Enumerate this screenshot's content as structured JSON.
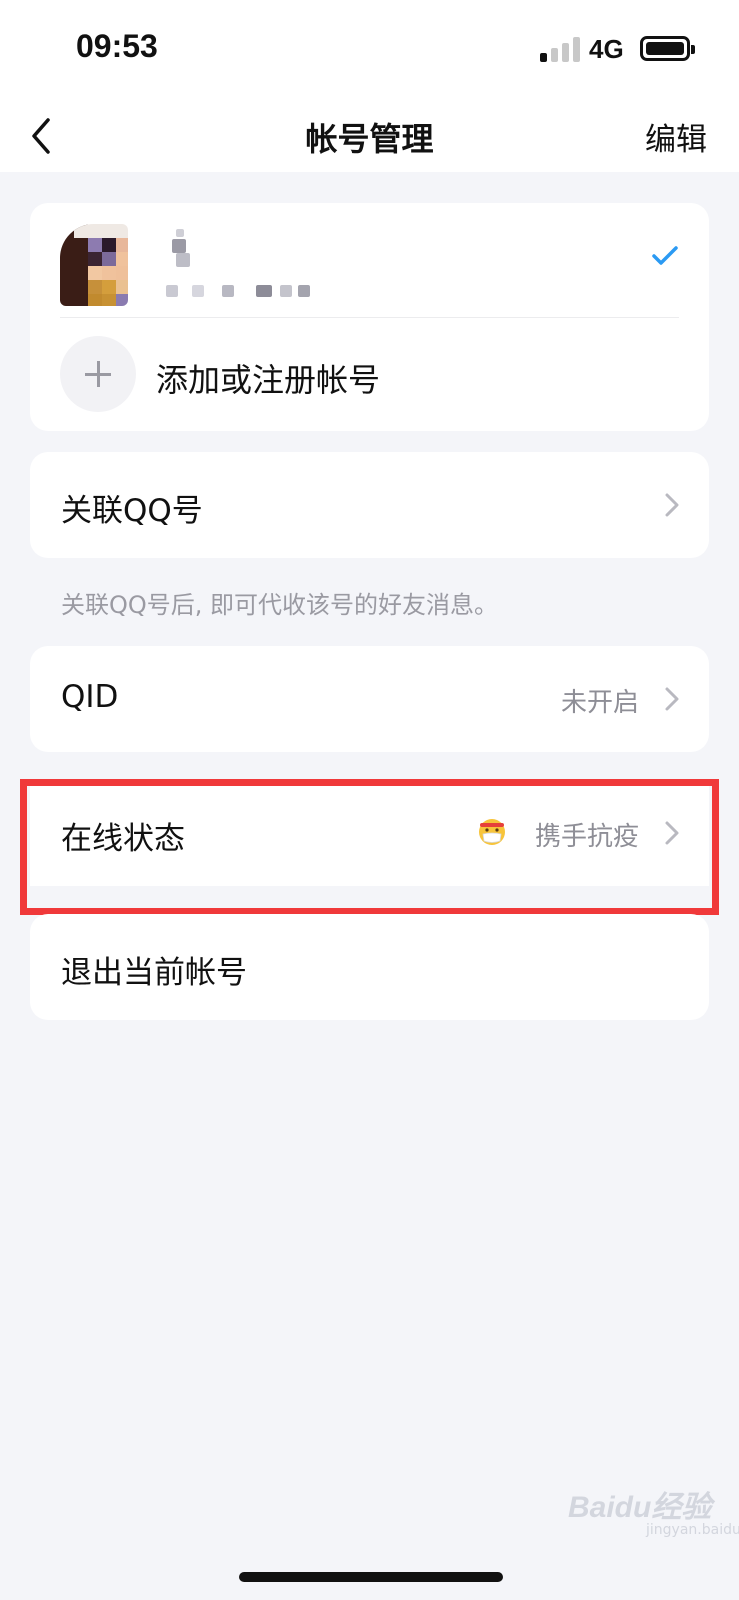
{
  "status_bar": {
    "time": "09:53",
    "network": "4G",
    "signal_bars_on": 1,
    "signal_bars_total": 4,
    "battery_level": 1.0
  },
  "nav": {
    "back_icon": "chevron-left-icon",
    "title": "帐号管理",
    "edit_label": "编辑"
  },
  "account_card": {
    "current_account_selected_icon": "checkmark-icon",
    "add_icon": "plus-icon",
    "add_label": "添加或注册帐号"
  },
  "settings": {
    "link_qq": {
      "label": "关联QQ号",
      "hint": "关联QQ号后, 即可代收该号的好友消息。"
    },
    "qid": {
      "label": "QID",
      "value": "未开启"
    },
    "online_status": {
      "label": "在线状态",
      "icon": "masked-face-emoji-icon",
      "value": "携手抗疫"
    },
    "logout": {
      "label": "退出当前帐号"
    }
  },
  "colors": {
    "background": "#f4f5f9",
    "card": "#ffffff",
    "accent_check": "#2b9af3",
    "highlight": "#f0393a",
    "secondary_text": "#8e8e96"
  },
  "watermark": {
    "main": "Baidu经验",
    "sub": "jingyan.baidu.com"
  }
}
